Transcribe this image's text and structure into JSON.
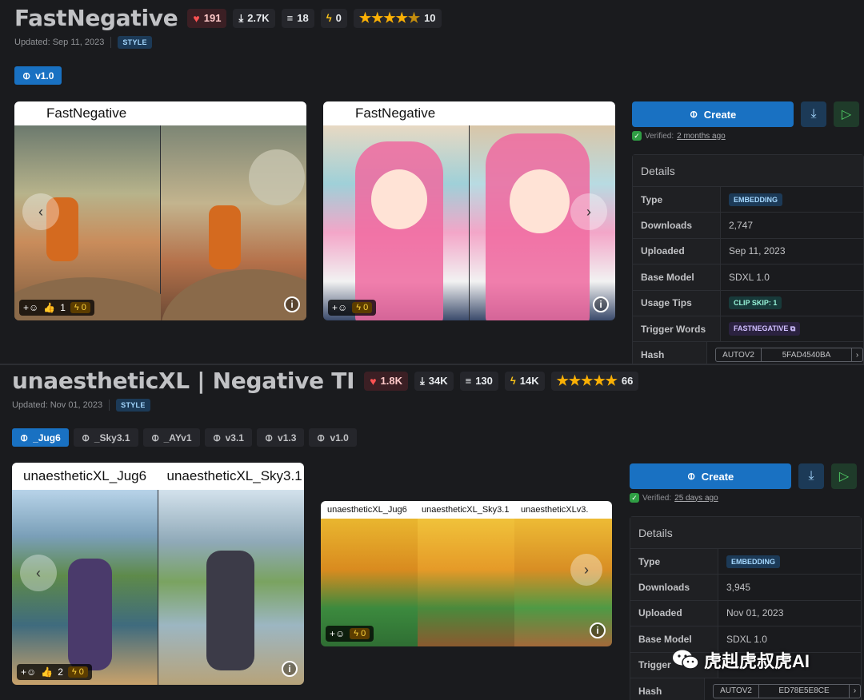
{
  "model1": {
    "title": "FastNegative",
    "stats": {
      "likes": "191",
      "downloads": "2.7K",
      "reviews": "18",
      "buzz": "0",
      "rating_count": "10"
    },
    "updated": "Updated: Sep 11, 2023",
    "tag": "STYLE",
    "versions": [
      "v1.0"
    ],
    "card1_header": [
      "FastNegative"
    ],
    "card2_header": [
      "FastNegative"
    ],
    "card1_reactions": {
      "likes": "1",
      "buzz": "0"
    },
    "card2_reactions": {
      "buzz": "0"
    },
    "create_label": "Create",
    "verified_label": "Verified:",
    "verified_time": "2 months ago",
    "details_title": "Details",
    "details": [
      {
        "key": "Type",
        "value": "EMBEDDING"
      },
      {
        "key": "Downloads",
        "value": "2,747"
      },
      {
        "key": "Uploaded",
        "value": "Sep 11, 2023"
      },
      {
        "key": "Base Model",
        "value": "SDXL 1.0"
      },
      {
        "key": "Usage Tips",
        "value": "CLIP SKIP: 1"
      },
      {
        "key": "Trigger Words",
        "value": "FASTNEGATIVE"
      },
      {
        "key": "Hash",
        "value": "5FAD4540BA",
        "algo": "AUTOV2"
      }
    ]
  },
  "model2": {
    "title": "unaestheticXL | Negative TI",
    "stats": {
      "likes": "1.8K",
      "downloads": "34K",
      "reviews": "130",
      "buzz": "14K",
      "rating_count": "66"
    },
    "updated": "Updated: Nov 01, 2023",
    "tag": "STYLE",
    "versions": [
      "_Jug6",
      "_Sky3.1",
      "_AYv1",
      "v3.1",
      "v1.3",
      "v1.0"
    ],
    "card1_header": [
      "unaestheticXL_Jug6",
      "unaestheticXL_Sky3.1"
    ],
    "card2_header": [
      "unaestheticXL_Jug6",
      "unaestheticXL_Sky3.1",
      "unaestheticXLv3."
    ],
    "card1_reactions": {
      "likes": "2",
      "buzz": "0"
    },
    "card2_reactions": {
      "buzz": "0"
    },
    "create_label": "Create",
    "verified_label": "Verified:",
    "verified_time": "25 days ago",
    "details_title": "Details",
    "details": [
      {
        "key": "Type",
        "value": "EMBEDDING"
      },
      {
        "key": "Downloads",
        "value": "3,945"
      },
      {
        "key": "Uploaded",
        "value": "Nov 01, 2023"
      },
      {
        "key": "Base Model",
        "value": "SDXL 1.0"
      },
      {
        "key": "Trigger",
        "value": ""
      },
      {
        "key": "Hash",
        "value": "ED78E5E8CE",
        "algo": "AUTOV2"
      }
    ]
  },
  "watermark": "虎赳虎叔虎AI"
}
